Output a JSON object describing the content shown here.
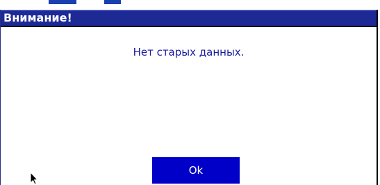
{
  "dialog": {
    "title": "Внимание!",
    "message": "Нет старых данных.",
    "ok_label": "Ok"
  },
  "colors": {
    "title_bar": "#1d2a96",
    "button": "#0000c8",
    "message_text": "#1a1aa0"
  },
  "icons": {
    "cursor": "mouse-pointer-icon"
  }
}
